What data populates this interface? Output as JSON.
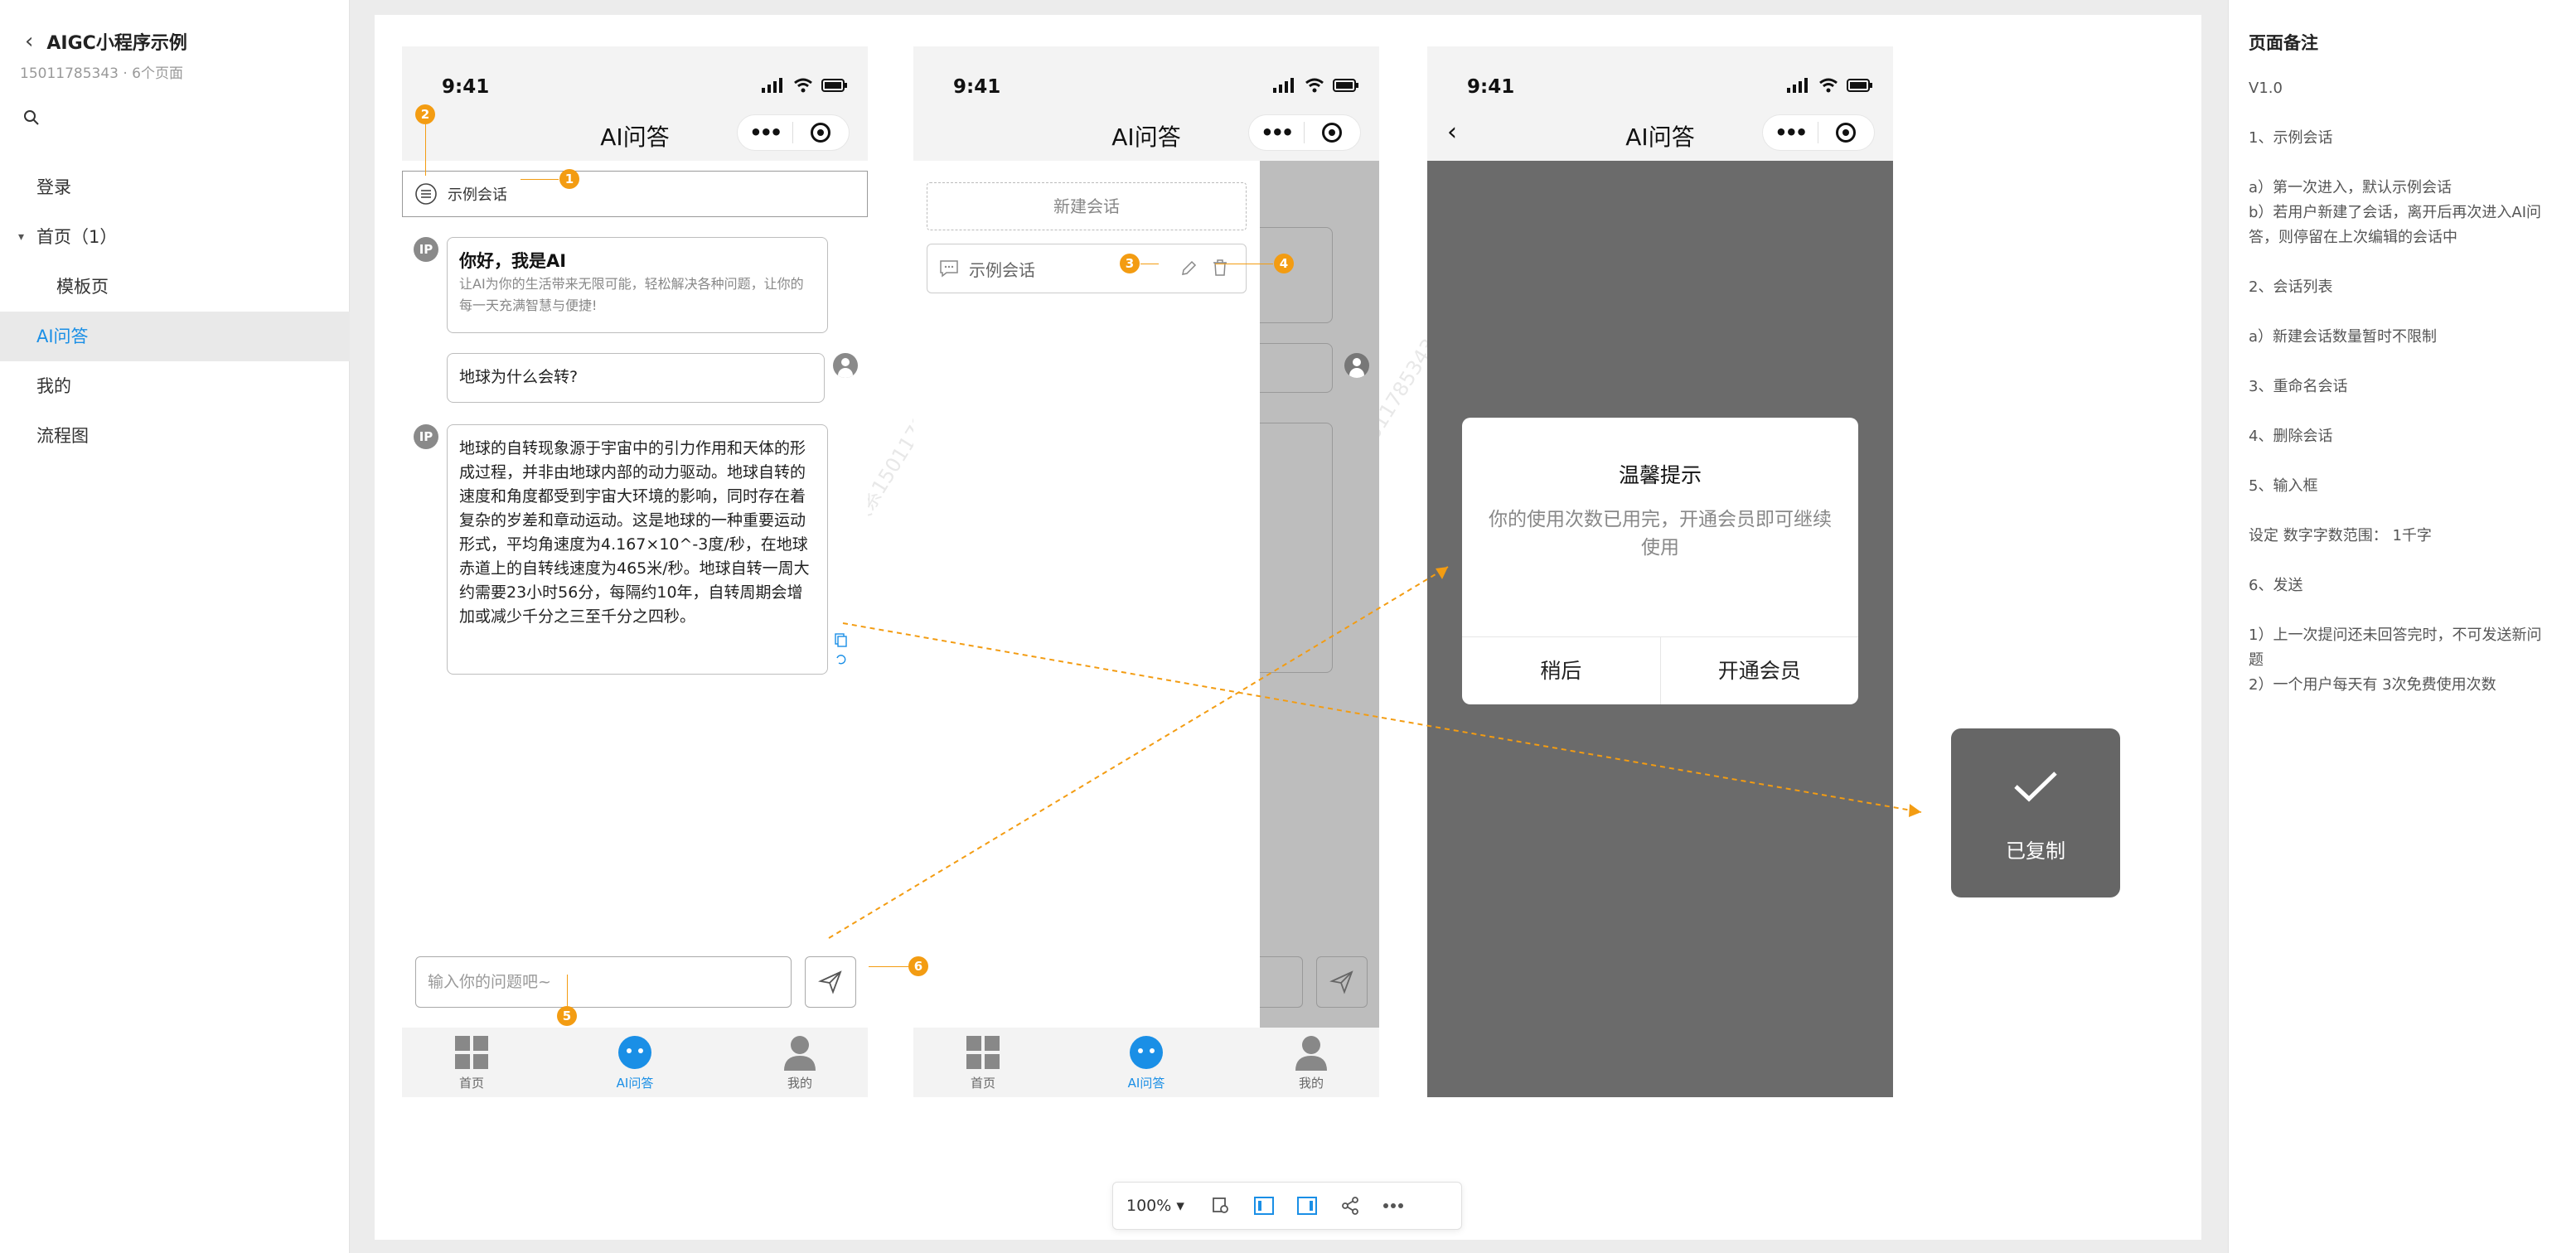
{
  "project": {
    "title": "AIGC小程序示例",
    "meta": "15011785343 · 6个页面"
  },
  "sidebar": {
    "items": [
      {
        "label": "登录"
      },
      {
        "label": "首页（1）"
      },
      {
        "label": "模板页"
      },
      {
        "label": "AI问答"
      },
      {
        "label": "我的"
      },
      {
        "label": "流程图"
      }
    ]
  },
  "phone": {
    "time": "9:41",
    "title": "AI问答",
    "session_label": "示例会话",
    "ai_badge": "IP",
    "greeting_title": "你好，我是AI",
    "greeting_sub": "让AI为你的生活带来无限可能，轻松解决各种问题，让你的每一天充满智慧与便捷!",
    "user_question": "地球为什么会转?",
    "ai_answer": "地球的自转现象源于宇宙中的引力作用和天体的形成过程，并非由地球内部的动力驱动。地球自转的速度和角度都受到宇宙大环境的影响，同时存在着复杂的岁差和章动运动。这是地球的一种重要运动形式，平均角速度为4.167×10^-3度/秒，在地球赤道上的自转线速度为465米/秒。地球自转一周大约需要23小时56分，每隔约10年，自转周期会增加或减少千分之三至千分之四秒。",
    "input_placeholder": "输入你的问题吧~",
    "tabs": [
      {
        "label": "首页"
      },
      {
        "label": "AI问答"
      },
      {
        "label": "我的"
      }
    ]
  },
  "drawer": {
    "new_session": "新建会话",
    "session_item": "示例会话"
  },
  "modal": {
    "title": "温馨提示",
    "content": "你的使用次数已用完，开通会员即可继续使用",
    "cancel": "稍后",
    "confirm": "开通会员"
  },
  "toast": {
    "label": "已复制"
  },
  "badges": [
    "1",
    "2",
    "3",
    "4",
    "5",
    "6"
  ],
  "watermark": "仅供参考·请联系15011785343",
  "notes": {
    "title": "页面备注",
    "lines": [
      "V1.0",
      "",
      "1、示例会话",
      "",
      "a）第一次进入，默认示例会话",
      "b）若用户新建了会话，离开后再次进入AI问",
      "答，则停留在上次编辑的会话中",
      "",
      "2、会话列表",
      "",
      "a）新建会话数量暂时不限制",
      "",
      "3、重命名会话",
      "",
      "4、删除会话",
      "",
      "5、输入框",
      "",
      "设定 数字字数范围： 1千字",
      "",
      "6、发送",
      "",
      "1）上一次提问还未回答完时，不可发送新问",
      "题",
      "2）一个用户每天有 3次免费使用次数"
    ]
  },
  "toolbar": {
    "zoom": "100%"
  },
  "colors": {
    "accent": "#1a8fe6",
    "annotation": "#f39c12",
    "modal_bg": "#6b6b6b"
  }
}
